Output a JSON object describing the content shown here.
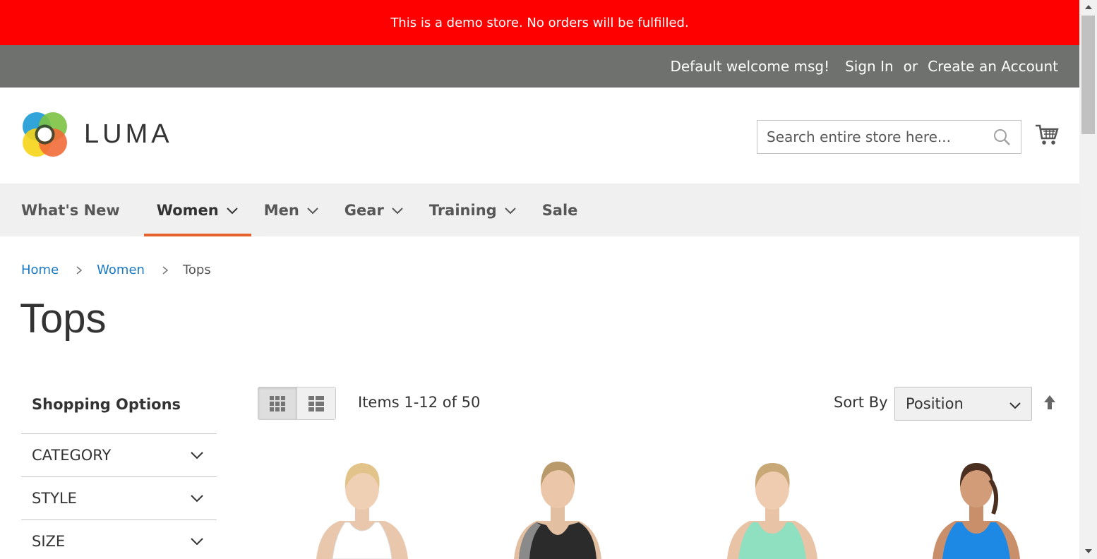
{
  "demo_notice": "This is a demo store. No orders will be fulfilled.",
  "panel": {
    "welcome": "Default welcome msg!",
    "sign_in": "Sign In",
    "or": "or",
    "create_account": "Create an Account"
  },
  "header": {
    "logo_text": "LUMA",
    "search_placeholder": "Search entire store here...",
    "cart_icon": "cart-icon"
  },
  "nav": {
    "items": [
      {
        "label": "What's New",
        "has_dropdown": false
      },
      {
        "label": "Women",
        "has_dropdown": true,
        "active": true
      },
      {
        "label": "Men",
        "has_dropdown": true
      },
      {
        "label": "Gear",
        "has_dropdown": true
      },
      {
        "label": "Training",
        "has_dropdown": true
      },
      {
        "label": "Sale",
        "has_dropdown": false
      }
    ],
    "active_color": "#e5632b"
  },
  "breadcrumb": {
    "home": "Home",
    "women": "Women",
    "current": "Tops"
  },
  "page_title": "Tops",
  "sidebar": {
    "title": "Shopping Options",
    "filters": [
      "CATEGORY",
      "STYLE",
      "SIZE"
    ]
  },
  "toolbar": {
    "amount": "Items 1-12 of 50",
    "sort_label": "Sort By",
    "sort_value": "Position",
    "view_modes": [
      "grid",
      "list"
    ],
    "active_mode": "grid"
  },
  "products": [
    {
      "top_color": "#ffffff",
      "hair": "#e2c48a"
    },
    {
      "top_color": "#2b2b2b",
      "hair": "#b99a6b"
    },
    {
      "top_color": "#8fe0c0",
      "hair": "#c9a878"
    },
    {
      "top_color": "#1e88e5",
      "hair": "#4a2e1f"
    }
  ],
  "colors": {
    "demo_bar": "#ff0000",
    "panel": "#6e716e",
    "link": "#1979c3"
  }
}
